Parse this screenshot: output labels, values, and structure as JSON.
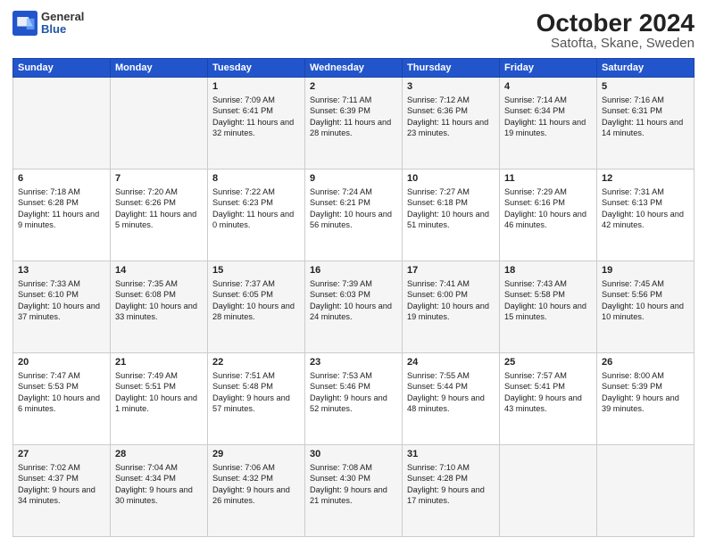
{
  "header": {
    "logo": {
      "general": "General",
      "blue": "Blue"
    },
    "title": "October 2024",
    "subtitle": "Satofta, Skane, Sweden"
  },
  "columns": [
    "Sunday",
    "Monday",
    "Tuesday",
    "Wednesday",
    "Thursday",
    "Friday",
    "Saturday"
  ],
  "rows": [
    [
      {
        "day": "",
        "info": ""
      },
      {
        "day": "",
        "info": ""
      },
      {
        "day": "1",
        "info": "Sunrise: 7:09 AM\nSunset: 6:41 PM\nDaylight: 11 hours and 32 minutes."
      },
      {
        "day": "2",
        "info": "Sunrise: 7:11 AM\nSunset: 6:39 PM\nDaylight: 11 hours and 28 minutes."
      },
      {
        "day": "3",
        "info": "Sunrise: 7:12 AM\nSunset: 6:36 PM\nDaylight: 11 hours and 23 minutes."
      },
      {
        "day": "4",
        "info": "Sunrise: 7:14 AM\nSunset: 6:34 PM\nDaylight: 11 hours and 19 minutes."
      },
      {
        "day": "5",
        "info": "Sunrise: 7:16 AM\nSunset: 6:31 PM\nDaylight: 11 hours and 14 minutes."
      }
    ],
    [
      {
        "day": "6",
        "info": "Sunrise: 7:18 AM\nSunset: 6:28 PM\nDaylight: 11 hours and 9 minutes."
      },
      {
        "day": "7",
        "info": "Sunrise: 7:20 AM\nSunset: 6:26 PM\nDaylight: 11 hours and 5 minutes."
      },
      {
        "day": "8",
        "info": "Sunrise: 7:22 AM\nSunset: 6:23 PM\nDaylight: 11 hours and 0 minutes."
      },
      {
        "day": "9",
        "info": "Sunrise: 7:24 AM\nSunset: 6:21 PM\nDaylight: 10 hours and 56 minutes."
      },
      {
        "day": "10",
        "info": "Sunrise: 7:27 AM\nSunset: 6:18 PM\nDaylight: 10 hours and 51 minutes."
      },
      {
        "day": "11",
        "info": "Sunrise: 7:29 AM\nSunset: 6:16 PM\nDaylight: 10 hours and 46 minutes."
      },
      {
        "day": "12",
        "info": "Sunrise: 7:31 AM\nSunset: 6:13 PM\nDaylight: 10 hours and 42 minutes."
      }
    ],
    [
      {
        "day": "13",
        "info": "Sunrise: 7:33 AM\nSunset: 6:10 PM\nDaylight: 10 hours and 37 minutes."
      },
      {
        "day": "14",
        "info": "Sunrise: 7:35 AM\nSunset: 6:08 PM\nDaylight: 10 hours and 33 minutes."
      },
      {
        "day": "15",
        "info": "Sunrise: 7:37 AM\nSunset: 6:05 PM\nDaylight: 10 hours and 28 minutes."
      },
      {
        "day": "16",
        "info": "Sunrise: 7:39 AM\nSunset: 6:03 PM\nDaylight: 10 hours and 24 minutes."
      },
      {
        "day": "17",
        "info": "Sunrise: 7:41 AM\nSunset: 6:00 PM\nDaylight: 10 hours and 19 minutes."
      },
      {
        "day": "18",
        "info": "Sunrise: 7:43 AM\nSunset: 5:58 PM\nDaylight: 10 hours and 15 minutes."
      },
      {
        "day": "19",
        "info": "Sunrise: 7:45 AM\nSunset: 5:56 PM\nDaylight: 10 hours and 10 minutes."
      }
    ],
    [
      {
        "day": "20",
        "info": "Sunrise: 7:47 AM\nSunset: 5:53 PM\nDaylight: 10 hours and 6 minutes."
      },
      {
        "day": "21",
        "info": "Sunrise: 7:49 AM\nSunset: 5:51 PM\nDaylight: 10 hours and 1 minute."
      },
      {
        "day": "22",
        "info": "Sunrise: 7:51 AM\nSunset: 5:48 PM\nDaylight: 9 hours and 57 minutes."
      },
      {
        "day": "23",
        "info": "Sunrise: 7:53 AM\nSunset: 5:46 PM\nDaylight: 9 hours and 52 minutes."
      },
      {
        "day": "24",
        "info": "Sunrise: 7:55 AM\nSunset: 5:44 PM\nDaylight: 9 hours and 48 minutes."
      },
      {
        "day": "25",
        "info": "Sunrise: 7:57 AM\nSunset: 5:41 PM\nDaylight: 9 hours and 43 minutes."
      },
      {
        "day": "26",
        "info": "Sunrise: 8:00 AM\nSunset: 5:39 PM\nDaylight: 9 hours and 39 minutes."
      }
    ],
    [
      {
        "day": "27",
        "info": "Sunrise: 7:02 AM\nSunset: 4:37 PM\nDaylight: 9 hours and 34 minutes."
      },
      {
        "day": "28",
        "info": "Sunrise: 7:04 AM\nSunset: 4:34 PM\nDaylight: 9 hours and 30 minutes."
      },
      {
        "day": "29",
        "info": "Sunrise: 7:06 AM\nSunset: 4:32 PM\nDaylight: 9 hours and 26 minutes."
      },
      {
        "day": "30",
        "info": "Sunrise: 7:08 AM\nSunset: 4:30 PM\nDaylight: 9 hours and 21 minutes."
      },
      {
        "day": "31",
        "info": "Sunrise: 7:10 AM\nSunset: 4:28 PM\nDaylight: 9 hours and 17 minutes."
      },
      {
        "day": "",
        "info": ""
      },
      {
        "day": "",
        "info": ""
      }
    ]
  ]
}
